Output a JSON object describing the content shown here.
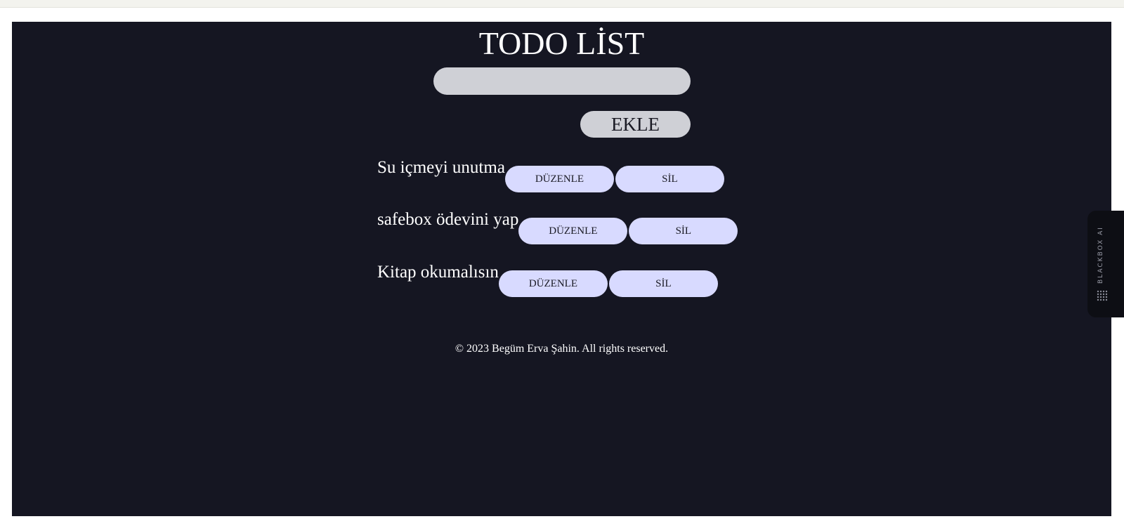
{
  "app": {
    "title": "TODO LİST",
    "input": {
      "value": "",
      "placeholder": ""
    },
    "add_label": "EKLE"
  },
  "todos": [
    {
      "text": "Su içmeyi unutma",
      "edit_label": "DÜZENLE",
      "delete_label": "SİL"
    },
    {
      "text": "safebox ödevini yap",
      "edit_label": "DÜZENLE",
      "delete_label": "SİL"
    },
    {
      "text": "Kitap okumalısın",
      "edit_label": "DÜZENLE",
      "delete_label": "SİL"
    }
  ],
  "footer": {
    "text": "© 2023 Begüm Erva Şahin. All rights reserved."
  },
  "side_tab": {
    "label": "BLACKBOX AI",
    "icon": "dot-grid-icon"
  },
  "colors": {
    "background": "#151622",
    "input_bg": "#cfd0d6",
    "button_bg": "#d8daff",
    "text": "#ffffff"
  }
}
